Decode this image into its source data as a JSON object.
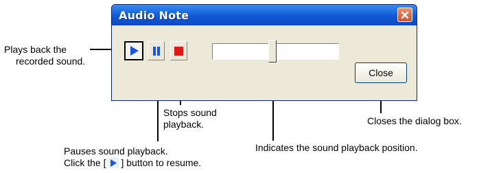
{
  "dialog": {
    "title": "Audio Note",
    "close_button_label": "Close"
  },
  "callouts": {
    "play": [
      "Plays back the",
      "recorded sound."
    ],
    "stop": [
      "Stops sound",
      "playback."
    ],
    "pause_line1": "Pauses sound playback.",
    "pause_line2_prefix": "Click the [",
    "pause_line2_suffix": "] button to resume.",
    "position": "Indicates the sound playback position.",
    "close": "Closes the dialog box."
  },
  "colors": {
    "titlebar": "#1058d4",
    "dialog_bg": "#ECE9D8",
    "play_icon": "#1a55e0",
    "pause_icon": "#1a55e0",
    "stop_icon": "#dd1a1a",
    "close_x_bg": "#d5502a"
  },
  "icons": {
    "play": "play-icon",
    "pause": "pause-icon",
    "stop": "stop-icon",
    "window_close": "close-icon"
  }
}
